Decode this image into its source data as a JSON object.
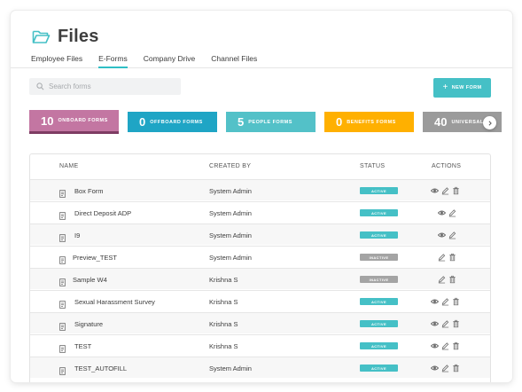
{
  "header": {
    "title": "Files"
  },
  "tabs": [
    {
      "label": "Employee Files"
    },
    {
      "label": "E-Forms"
    },
    {
      "label": "Company Drive"
    },
    {
      "label": "Channel Files"
    }
  ],
  "search": {
    "placeholder": "Search forms",
    "value": ""
  },
  "new_form_button": {
    "label": "NEW FORM"
  },
  "stats": [
    {
      "count": "10",
      "label": "ONBOARD FORMS",
      "color": "#c376a2",
      "selected": true
    },
    {
      "count": "0",
      "label": "OFFBOARD FORMS",
      "color": "#1fa5c5"
    },
    {
      "count": "5",
      "label": "PEOPLE FORMS",
      "color": "#53c1c8"
    },
    {
      "count": "0",
      "label": "BENEFITS FORMS",
      "color": "#ffb000"
    },
    {
      "count": "40",
      "label": "UNIVERSAL",
      "color": "#9b9b9b"
    }
  ],
  "table": {
    "columns": {
      "name": "NAME",
      "created_by": "CREATED BY",
      "status": "STATUS",
      "actions": "ACTIONS"
    },
    "rows": [
      {
        "name": "Box Form",
        "created_by": "System Admin",
        "status": "ACTIVE",
        "actions": [
          "view",
          "edit",
          "delete"
        ]
      },
      {
        "name": "Direct Deposit ADP",
        "created_by": "System Admin",
        "status": "ACTIVE",
        "actions": [
          "view",
          "edit"
        ]
      },
      {
        "name": "I9",
        "created_by": "System Admin",
        "status": "ACTIVE",
        "actions": [
          "view",
          "edit"
        ]
      },
      {
        "name": "Preview_TEST",
        "created_by": "System Admin",
        "status": "INACTIVE",
        "actions": [
          "edit",
          "delete"
        ]
      },
      {
        "name": "Sample W4",
        "created_by": "Krishna S",
        "status": "INACTIVE",
        "actions": [
          "edit",
          "delete"
        ]
      },
      {
        "name": "Sexual Harassment Survey",
        "created_by": "Krishna S",
        "status": "ACTIVE",
        "actions": [
          "view",
          "edit",
          "delete"
        ]
      },
      {
        "name": "Signature",
        "created_by": "Krishna S",
        "status": "ACTIVE",
        "actions": [
          "view",
          "edit",
          "delete"
        ]
      },
      {
        "name": "TEST",
        "created_by": "Krishna S",
        "status": "ACTIVE",
        "actions": [
          "view",
          "edit",
          "delete"
        ]
      },
      {
        "name": "TEST_AUTOFILL",
        "created_by": "System Admin",
        "status": "ACTIVE",
        "actions": [
          "view",
          "edit",
          "delete"
        ]
      }
    ]
  },
  "colors": {
    "accent": "#45c0c6",
    "active_status": "#45c0c6",
    "inactive_status": "#a4a4a4",
    "icon": "#6f6f6f"
  },
  "icons": {
    "folder": "open-folder-icon",
    "search": "search-icon",
    "add": "plus-icon",
    "scroll": "chevron-right-icon",
    "row": "document-icon",
    "view": "eye-icon",
    "edit": "pencil-icon",
    "delete": "trash-icon"
  }
}
